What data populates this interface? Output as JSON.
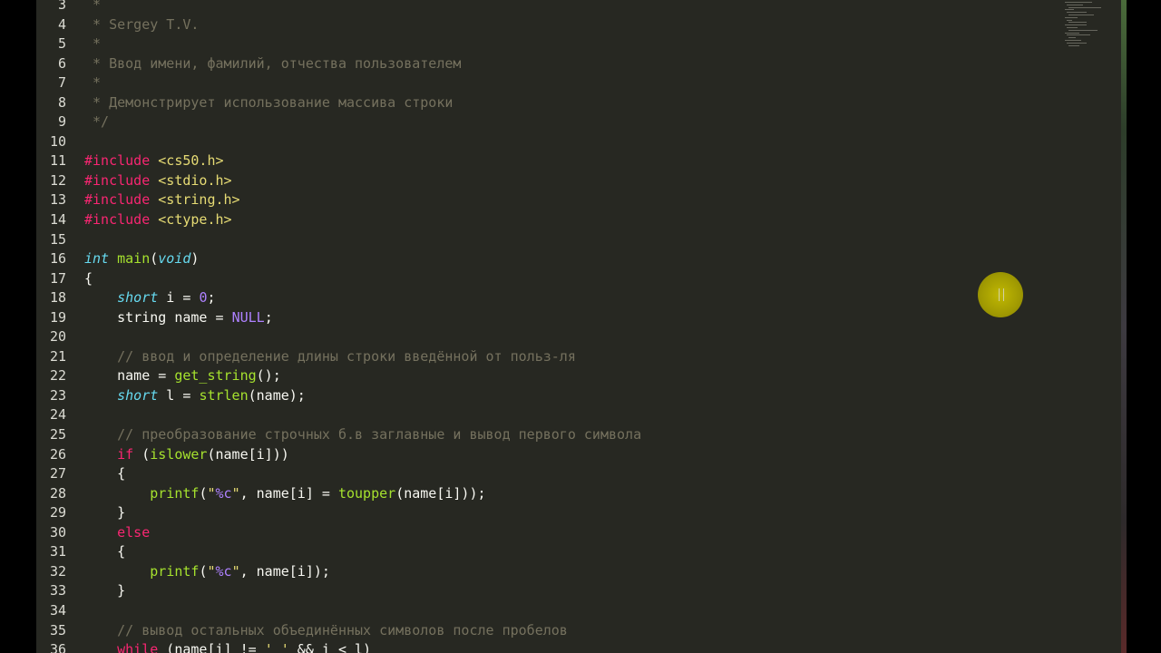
{
  "editor": {
    "lines": [
      {
        "n": "3",
        "html": "<span class=\"cm\"> *</span>"
      },
      {
        "n": "4",
        "html": "<span class=\"cm\"> * Sergey T.V.</span>"
      },
      {
        "n": "5",
        "html": "<span class=\"cm\"> *</span>"
      },
      {
        "n": "6",
        "html": "<span class=\"cm\"> * Ввод имени, фамилий, отчества пользователем</span>"
      },
      {
        "n": "7",
        "html": "<span class=\"cm\"> *</span>"
      },
      {
        "n": "8",
        "html": "<span class=\"cm\"> * Демонстрирует использование массива строки</span>"
      },
      {
        "n": "9",
        "html": "<span class=\"cm\"> */</span>"
      },
      {
        "n": "10",
        "html": ""
      },
      {
        "n": "11",
        "html": "<span class=\"pp\">#include</span> <span class=\"hd\">&lt;cs50.h&gt;</span>"
      },
      {
        "n": "12",
        "html": "<span class=\"pp\">#include</span> <span class=\"hd\">&lt;stdio.h&gt;</span>"
      },
      {
        "n": "13",
        "html": "<span class=\"pp\">#include</span> <span class=\"hd\">&lt;string.h&gt;</span>"
      },
      {
        "n": "14",
        "html": "<span class=\"pp\">#include</span> <span class=\"hd\">&lt;ctype.h&gt;</span>"
      },
      {
        "n": "15",
        "html": ""
      },
      {
        "n": "16",
        "html": "<span class=\"ty\">int</span> <span class=\"fn\">main</span>(<span class=\"ty\">void</span>)"
      },
      {
        "n": "17",
        "html": "{"
      },
      {
        "n": "18",
        "html": "    <span class=\"ty\">short</span> i = <span class=\"nu\">0</span>;"
      },
      {
        "n": "19",
        "html": "    string name = <span class=\"nu\">NULL</span>;"
      },
      {
        "n": "20",
        "html": ""
      },
      {
        "n": "21",
        "html": "    <span class=\"cm\">// ввод и определение длины строки введённой от польз-ля</span>"
      },
      {
        "n": "22",
        "html": "    name = <span class=\"fn\">get_string</span>();"
      },
      {
        "n": "23",
        "html": "    <span class=\"ty\">short</span> l = <span class=\"fn\">strlen</span>(name);"
      },
      {
        "n": "24",
        "html": ""
      },
      {
        "n": "25",
        "html": "    <span class=\"cm\">// преобразование строчных б.в заглавные и вывод первого символа</span>"
      },
      {
        "n": "26",
        "html": "    <span class=\"kw\">if</span> (<span class=\"fn\">islower</span>(name[i]))"
      },
      {
        "n": "27",
        "html": "    {"
      },
      {
        "n": "28",
        "html": "        <span class=\"fn\">printf</span>(<span class=\"st\">\"</span><span class=\"nu\">%c</span><span class=\"st\">\"</span>, name[i] = <span class=\"fn\">toupper</span>(name[i]));"
      },
      {
        "n": "29",
        "html": "    }"
      },
      {
        "n": "30",
        "html": "    <span class=\"kw\">else</span>"
      },
      {
        "n": "31",
        "html": "    {"
      },
      {
        "n": "32",
        "html": "        <span class=\"fn\">printf</span>(<span class=\"st\">\"</span><span class=\"nu\">%c</span><span class=\"st\">\"</span>, name[i]);"
      },
      {
        "n": "33",
        "html": "    }"
      },
      {
        "n": "34",
        "html": ""
      },
      {
        "n": "35",
        "html": "    <span class=\"cm\">// вывод остальных объединённых символов после пробелов</span>"
      },
      {
        "n": "36",
        "html": "    <span class=\"kw\">while</span> (name[i] != <span class=\"st\">' '</span> &amp;&amp; i &lt; l)"
      }
    ]
  },
  "colors": {
    "background": "#272822",
    "comment": "#75715e",
    "keyword": "#f92672",
    "string": "#e6db74",
    "type": "#66d9ef",
    "function": "#a6e22e",
    "number": "#ae81ff",
    "cursor_highlight": "#c9c000"
  }
}
